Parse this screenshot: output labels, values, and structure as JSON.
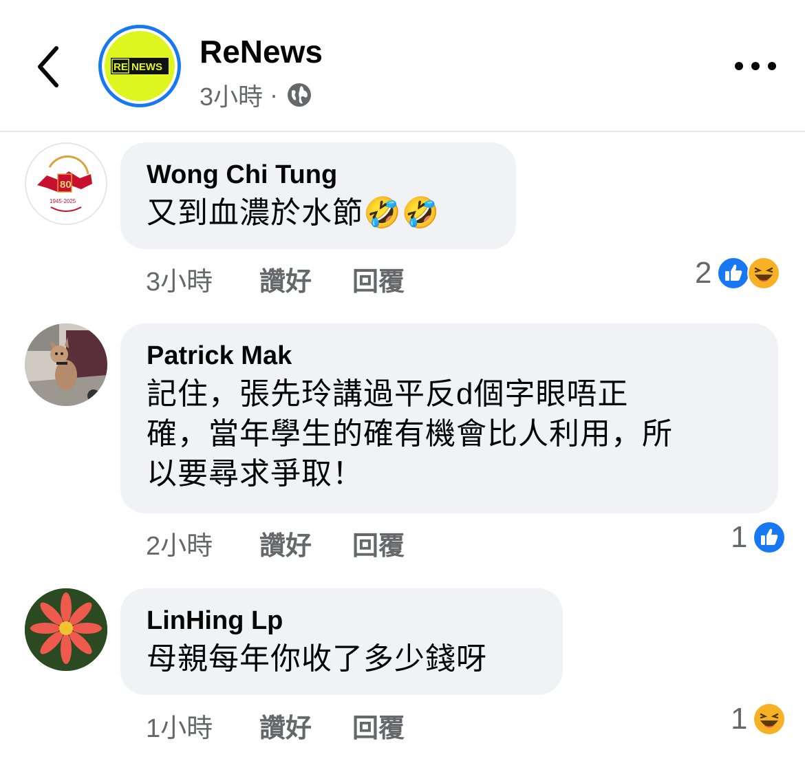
{
  "header": {
    "page_name": "ReNews",
    "time": "3小時",
    "separator": "·",
    "avatar_logo_text": "RE NEWS",
    "icons": [
      "back-chevron-icon",
      "globe-icon",
      "more-dots-icon"
    ]
  },
  "comments": [
    {
      "author": "Wong Chi Tung",
      "text": "又到血濃於水節🤣🤣",
      "time": "3小時",
      "like_label": "讚好",
      "reply_label": "回覆",
      "reaction_count": "2",
      "reactions": [
        "like-icon",
        "haha-icon"
      ]
    },
    {
      "author": "Patrick Mak",
      "text_lines": [
        "記住，張先玲講過平反d個字眼唔正",
        "確，當年學生的確有機會比人利用，所",
        "以要尋求爭取！"
      ],
      "time": "2小時",
      "like_label": "讚好",
      "reply_label": "回覆",
      "reaction_count": "1",
      "reactions": [
        "like-icon"
      ]
    },
    {
      "author": "LinHing Lp",
      "text": "母親每年你收了多少錢呀",
      "time": "1小時",
      "like_label": "讚好",
      "reply_label": "回覆",
      "reaction_count": "1",
      "reactions": [
        "haha-icon"
      ]
    }
  ],
  "colors": {
    "accent_blue": "#1877f2",
    "bubble_bg": "#f0f2f5",
    "secondary_text": "#65676b",
    "renews_yellow": "#dff51f"
  }
}
